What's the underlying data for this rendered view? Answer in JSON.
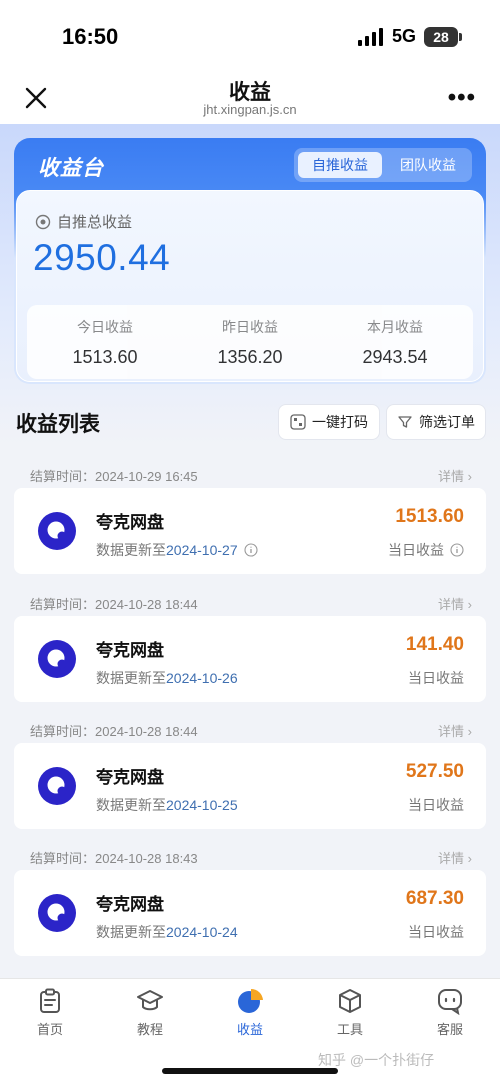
{
  "status": {
    "time": "16:50",
    "network": "5G",
    "battery": "28"
  },
  "nav": {
    "title": "收益",
    "url": "jht.xingpan.js.cn",
    "more": "•••"
  },
  "dashboard": {
    "title": "收益台",
    "tabs": {
      "self": "自推收益",
      "team": "团队收益"
    },
    "total_label": "自推总收益",
    "total_value": "2950.44",
    "stats": [
      {
        "label": "今日收益",
        "value": "1513.60"
      },
      {
        "label": "昨日收益",
        "value": "1356.20"
      },
      {
        "label": "本月收益",
        "value": "2943.54"
      }
    ]
  },
  "list": {
    "title": "收益列表",
    "code_button": "一键打码",
    "filter_button": "筛选订单",
    "items": [
      {
        "settle": "结算时间：2024-10-29 16:45",
        "detail": "详情 ›",
        "app": "夸克网盘",
        "update_prefix": "数据更新至",
        "update_date": "2024-10-27",
        "amount": "1513.60",
        "amount_label": "当日收益"
      },
      {
        "settle": "结算时间：2024-10-28 18:44",
        "detail": "详情 ›",
        "app": "夸克网盘",
        "update_prefix": "数据更新至",
        "update_date": "2024-10-26",
        "amount": "141.40",
        "amount_label": "当日收益"
      },
      {
        "settle": "结算时间：2024-10-28 18:44",
        "detail": "详情 ›",
        "app": "夸克网盘",
        "update_prefix": "数据更新至",
        "update_date": "2024-10-25",
        "amount": "527.50",
        "amount_label": "当日收益"
      },
      {
        "settle": "结算时间：2024-10-28 18:43",
        "detail": "详情 ›",
        "app": "夸克网盘",
        "update_prefix": "数据更新至",
        "update_date": "2024-10-24",
        "amount": "687.30",
        "amount_label": "当日收益"
      }
    ]
  },
  "tabbar": {
    "items": [
      {
        "label": "首页",
        "icon": "clipboard-icon"
      },
      {
        "label": "教程",
        "icon": "graduation-cap-icon"
      },
      {
        "label": "收益",
        "icon": "pie-chart-icon"
      },
      {
        "label": "工具",
        "icon": "box-icon"
      },
      {
        "label": "客服",
        "icon": "chat-bubble-icon"
      }
    ]
  },
  "watermark": "知乎 @一个扑街仔",
  "colors": {
    "accent": "#2a66d8",
    "amount": "#e0761a",
    "logo": "#2b24c8"
  }
}
